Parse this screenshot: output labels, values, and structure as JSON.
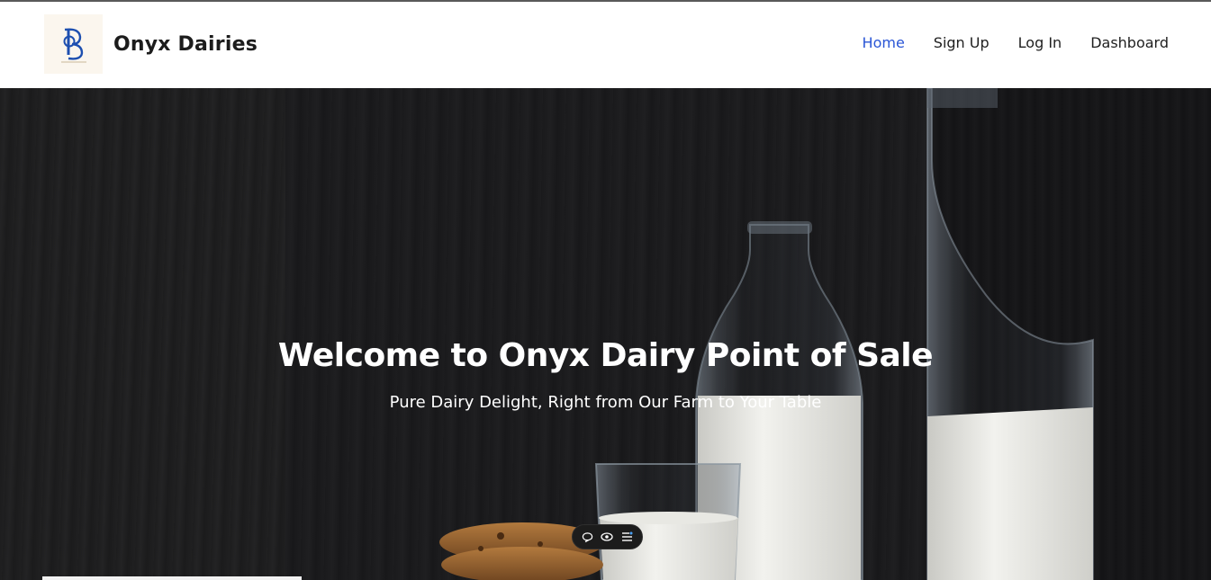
{
  "brand": {
    "name": "Onyx Dairies",
    "logo_icon": "od-monogram-logo"
  },
  "nav": {
    "items": [
      {
        "label": "Home",
        "active": true
      },
      {
        "label": "Sign Up",
        "active": false
      },
      {
        "label": "Log In",
        "active": false
      },
      {
        "label": "Dashboard",
        "active": false
      }
    ]
  },
  "hero": {
    "title": "Welcome to Onyx Dairy Point of Sale",
    "subtitle": "Pure Dairy Delight, Right from Our Farm to Your Table"
  },
  "toolbar": {
    "icons": [
      "comment-icon",
      "eye-icon",
      "menu-list-icon"
    ]
  },
  "colors": {
    "accent": "#2a56d6",
    "text_dark": "#1c1c1c",
    "hero_text": "#ffffff"
  }
}
